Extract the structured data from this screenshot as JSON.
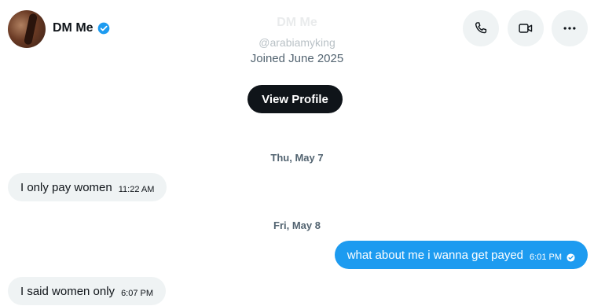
{
  "header": {
    "name": "DM Me",
    "verified_color": "#1d9bf0",
    "actions": [
      "phone-icon",
      "video-icon",
      "more-icon"
    ]
  },
  "profile": {
    "ghost_name": "DM Me",
    "handle": "@arabiamyking",
    "joined": "Joined June 2025",
    "view_profile_label": "View Profile"
  },
  "messages": [
    {
      "date": "Thu, May 7"
    },
    {
      "direction": "in",
      "text": "I only pay women",
      "time": "11:22 AM"
    },
    {
      "date": "Fri, May 8"
    },
    {
      "direction": "out",
      "text": "what about me i wanna get payed",
      "time": "6:01 PM"
    },
    {
      "direction": "in",
      "text": "I said women only",
      "time": "6:07 PM"
    }
  ]
}
